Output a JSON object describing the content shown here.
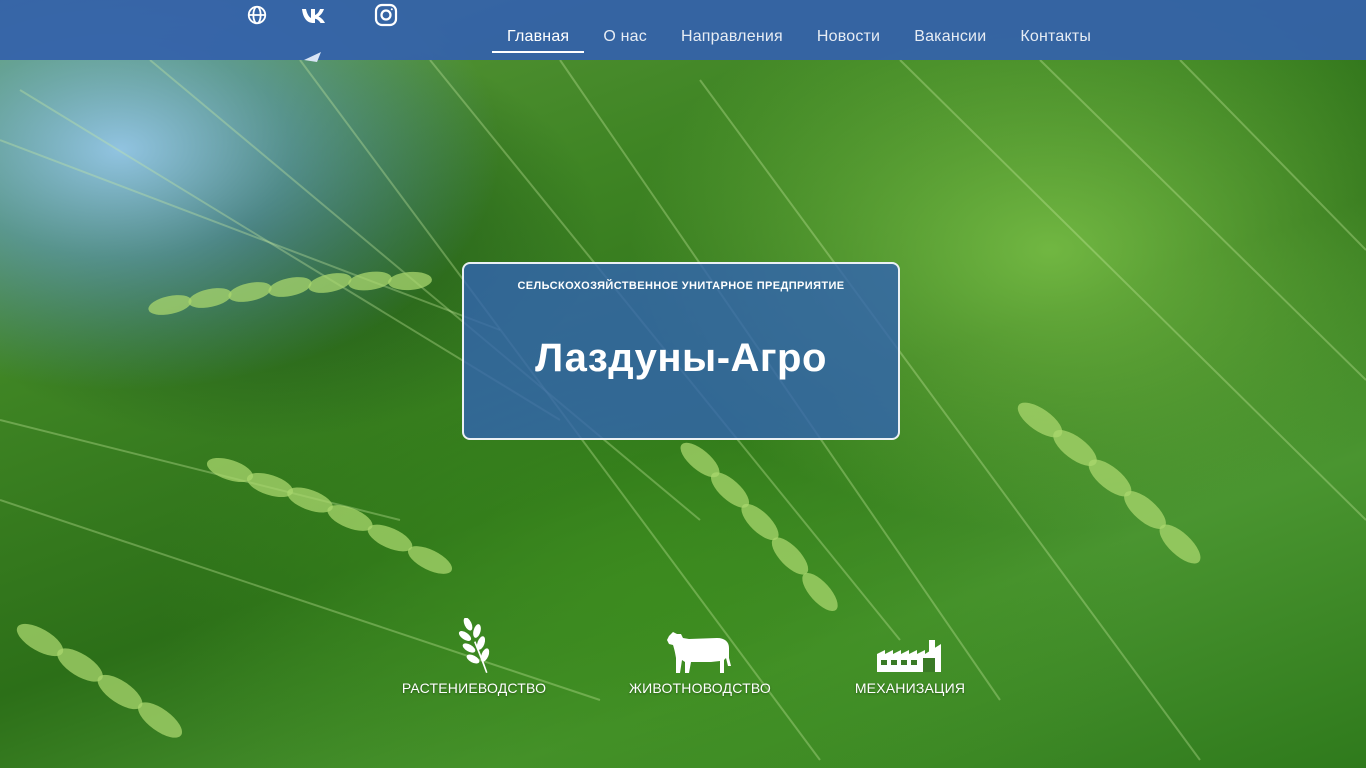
{
  "header": {
    "social": [
      {
        "icon": "globe-icon"
      },
      {
        "icon": "vk-icon"
      },
      {
        "icon": "instagram-icon"
      },
      {
        "icon": "telegram-icon"
      }
    ],
    "nav": [
      {
        "label": "Главная",
        "active": true
      },
      {
        "label": "О нас",
        "active": false
      },
      {
        "label": "Направления",
        "active": false
      },
      {
        "label": "Новости",
        "active": false
      },
      {
        "label": "Вакансии",
        "active": false
      },
      {
        "label": "Контакты",
        "active": false
      }
    ]
  },
  "hero": {
    "subtitle": "СЕЛЬСКОХОЗЯЙСТВЕННОЕ УНИТАРНОЕ ПРЕДПРИЯТИЕ",
    "title": "Лаздуны-Агро"
  },
  "directions": [
    {
      "label": "РАСТЕНИЕВОДСТВО",
      "icon": "wheat-icon"
    },
    {
      "label": "ЖИВОТНОВОДСТВО",
      "icon": "cow-icon"
    },
    {
      "label": "МЕХАНИЗАЦИЯ",
      "icon": "factory-icon"
    }
  ],
  "colors": {
    "header_bg": "#3462aa",
    "card_bg": "#3264af",
    "text": "#ffffff"
  }
}
